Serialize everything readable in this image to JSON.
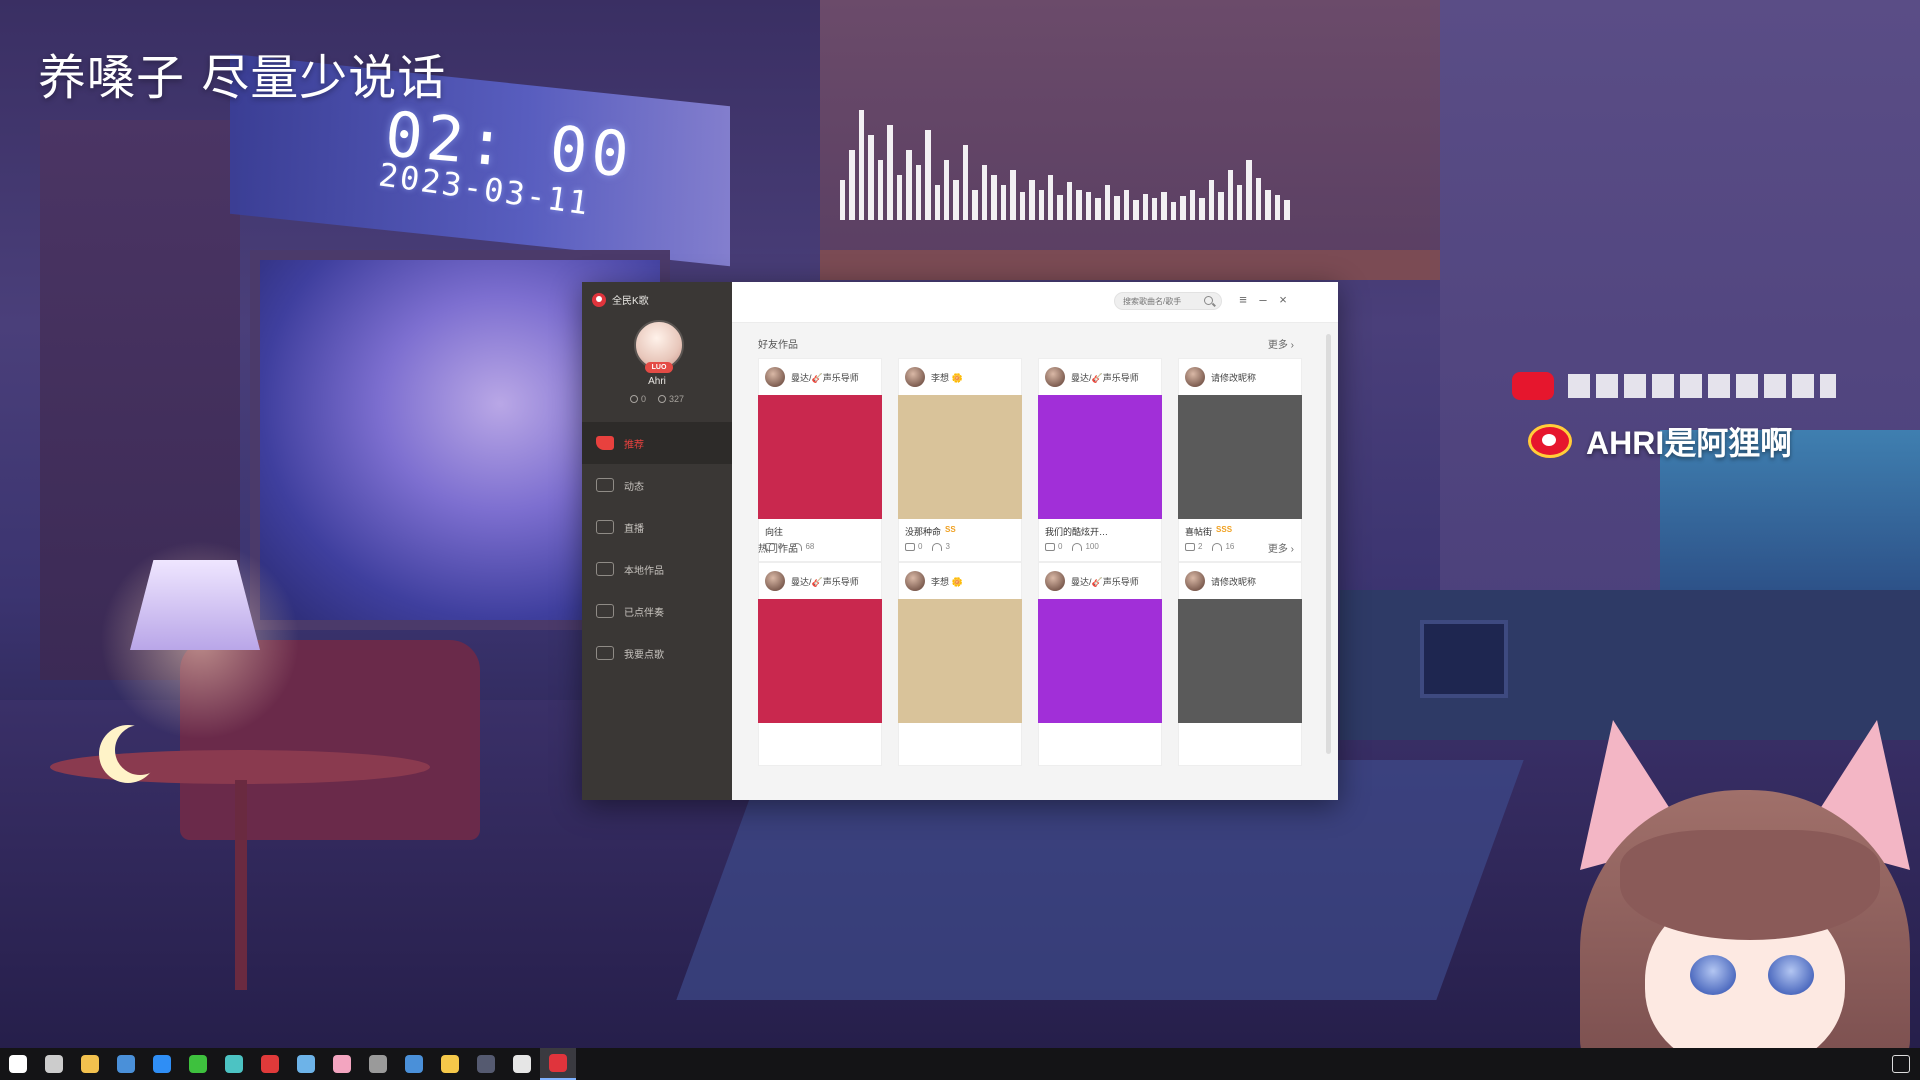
{
  "overlay": {
    "title": "养嗓子 尽量少说话",
    "clock": "02: 00",
    "date": "2023-03-11",
    "weibo_handle": "AHRI是阿狸啊"
  },
  "app": {
    "name": "全民K歌",
    "profile": {
      "vip_label": "LUO",
      "name": "Ahri",
      "following": "0",
      "followers": "327"
    },
    "nav": [
      {
        "label": "推荐",
        "icon": "thumbs-up-icon",
        "active": true
      },
      {
        "label": "动态",
        "icon": "chat-bubble-icon",
        "active": false
      },
      {
        "label": "直播",
        "icon": "video-icon",
        "active": false
      },
      {
        "label": "本地作品",
        "icon": "monitor-icon",
        "active": false
      },
      {
        "label": "已点伴奏",
        "icon": "playlist-icon",
        "active": false
      },
      {
        "label": "我要点歌",
        "icon": "microphone-icon",
        "active": false
      }
    ],
    "search_placeholder": "搜索歌曲名/歌手",
    "accent_color": "#e8413e",
    "sections": [
      {
        "title": "好友作品",
        "more": "更多 ›",
        "cards": [
          {
            "author": "曼达/🎸声乐导师",
            "title": "向往",
            "tier": "",
            "comments": "0",
            "listens": "68",
            "thumb_color": "#c9284e"
          },
          {
            "author": "李想 🌼",
            "title": "没那种命",
            "tier": "SS",
            "comments": "0",
            "listens": "3",
            "thumb_color": "#d9c39a"
          },
          {
            "author": "曼达/🎸声乐导师",
            "title": "我们的酷炫开…",
            "tier": "",
            "comments": "0",
            "listens": "100",
            "thumb_color": "#a12fd8"
          },
          {
            "author": "请修改昵称",
            "title": "喜帖街",
            "tier": "SSS",
            "comments": "2",
            "listens": "16",
            "thumb_color": "#5a5a5a"
          }
        ]
      },
      {
        "title": "热门作品",
        "more": "更多 ›",
        "cards": [
          {
            "author": "曼达/🎸声乐导师",
            "thumb_color": "#c9284e"
          },
          {
            "author": "李想 🌼",
            "thumb_color": "#d9c39a"
          },
          {
            "author": "曼达/🎸声乐导师",
            "thumb_color": "#a12fd8"
          },
          {
            "author": "请修改昵称",
            "thumb_color": "#5a5a5a"
          }
        ]
      }
    ]
  },
  "taskbar": {
    "items": [
      {
        "icon": "windows-start-icon",
        "color": "#ffffff"
      },
      {
        "icon": "task-view-icon",
        "color": "#cccccc"
      },
      {
        "icon": "file-explorer-icon",
        "color": "#f2c14e"
      },
      {
        "icon": "steam-like-icon",
        "color": "#4a90d9"
      },
      {
        "icon": "kugou-icon",
        "color": "#2f8ef5"
      },
      {
        "icon": "wechat-icon",
        "color": "#3ec13e"
      },
      {
        "icon": "media-editor-icon",
        "color": "#4cc3c3"
      },
      {
        "icon": "netease-music-icon",
        "color": "#e03a3a"
      },
      {
        "icon": "steam-icon",
        "color": "#6db3e8"
      },
      {
        "icon": "image-viewer-icon",
        "color": "#f3a5c0"
      },
      {
        "icon": "obs-icon",
        "color": "#9a9a9a"
      },
      {
        "icon": "browser-icon",
        "color": "#4a90d9"
      },
      {
        "icon": "qq-game-icon",
        "color": "#f5c84a"
      },
      {
        "icon": "se-app-icon",
        "color": "#555a70"
      },
      {
        "icon": "boat-app-icon",
        "color": "#e6e6e6"
      },
      {
        "icon": "quanmin-kge-icon",
        "color": "#e0343c",
        "active": true
      }
    ]
  }
}
